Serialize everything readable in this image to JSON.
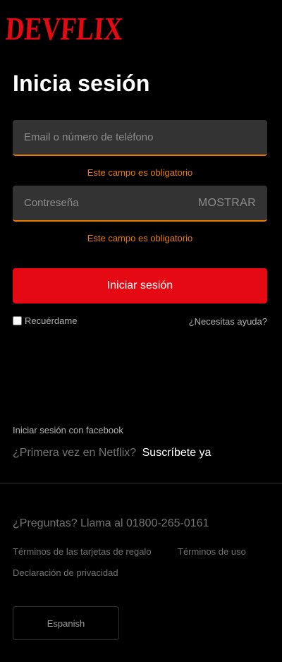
{
  "brand": {
    "logo_text": "DEVFLIX",
    "logo_color": "#e50914"
  },
  "login": {
    "title": "Inicia sesión",
    "email_placeholder": "Email o número de teléfono",
    "email_error": "Este campo es obligatorio",
    "password_placeholder": "Contreseña",
    "show_label": "MOSTRAR",
    "password_error": "Este campo es obligatorio",
    "submit_label": "Iniciar sesión",
    "remember_label": "Recuérdame",
    "help_label": "¿Necesitas ayuda?"
  },
  "social": {
    "facebook_label": "Iniciar sesión con facebook",
    "signup_prompt": "¿Primera vez en Netflix?",
    "signup_link": "Suscríbete ya"
  },
  "footer": {
    "questions": "¿Preguntas? Llama al 01800-265-0161",
    "links": [
      "Términos de las tarjetas de regalo",
      "Términos de uso",
      "Declaración de privacidad"
    ],
    "language": "Espanish"
  },
  "colors": {
    "accent": "#e50914",
    "error": "#e87c03",
    "field_bg": "#333333"
  }
}
